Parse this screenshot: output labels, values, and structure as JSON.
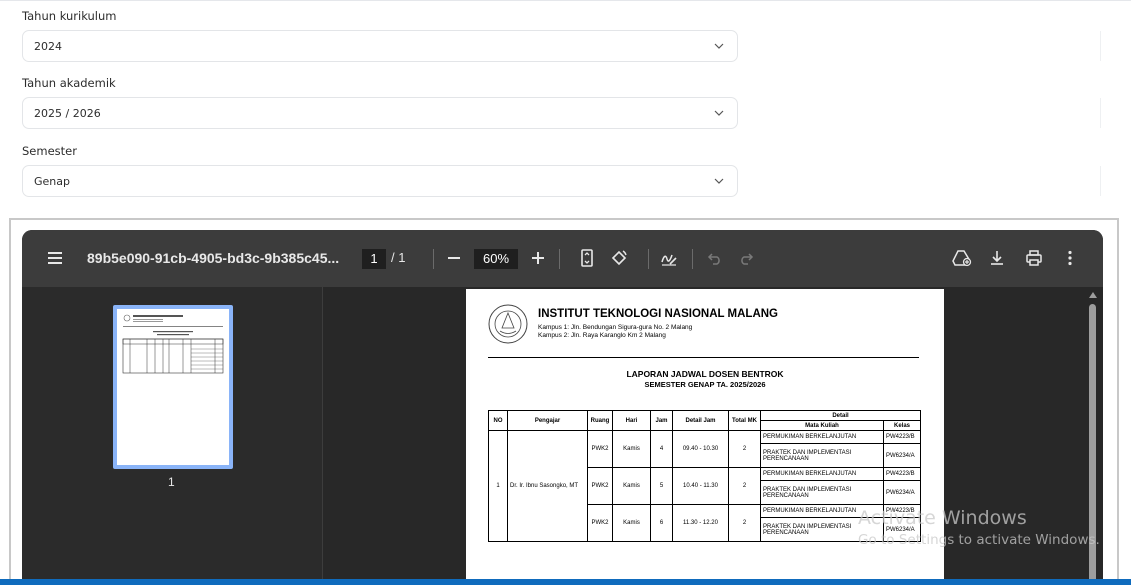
{
  "form": {
    "curriculum_year": {
      "label": "Tahun kurikulum",
      "value": "2024"
    },
    "academic_year": {
      "label": "Tahun akademik",
      "value": "2025 / 2026"
    },
    "semester": {
      "label": "Semester",
      "value": "Genap"
    }
  },
  "viewer": {
    "file_name": "89b5e090-91cb-4905-bd3c-9b385c45...",
    "current_page": "1",
    "page_separator": "/",
    "total_pages": "1",
    "zoom": "60%",
    "thumbnail_label": "1",
    "icons": {
      "menu": "menu-icon",
      "zoom_out": "minus-icon",
      "zoom_in": "plus-icon",
      "fit_page": "fit-page-icon",
      "rotate": "rotate-icon",
      "annotate": "pen-icon",
      "undo": "undo-icon",
      "redo": "redo-icon",
      "drive": "drive-add-icon",
      "download": "download-icon",
      "print": "print-icon",
      "more": "more-vertical-icon"
    }
  },
  "document": {
    "institution": "INSTITUT TEKNOLOGI NASIONAL MALANG",
    "campus1": "Kampus 1: Jln. Bendungan Sigura-gura No. 2 Malang",
    "campus2": "Kampus 2: Jln. Raya Karanglo Km 2 Malang",
    "report_title": "LAPORAN JADWAL DOSEN BENTROK",
    "report_subtitle": "SEMESTER GENAP TA. 2025/2026",
    "table": {
      "headers": {
        "no": "NO",
        "lecturer": "Pengajar",
        "room": "Ruang",
        "day": "Hari",
        "hour": "Jam",
        "time_detail": "Detail Jam",
        "total_mk": "Total MK",
        "detail": "Detail",
        "course": "Mata Kuliah",
        "class": "Kelas"
      },
      "no": "1",
      "lecturer": "Dr. Ir. Ibnu Sasongko, MT",
      "groups": [
        {
          "room": "PWK2",
          "day": "Kamis",
          "hour": "4",
          "time": "09.40 - 10.30",
          "total": "2",
          "courses": [
            {
              "name": "PERMUKIMAN BERKELANJUTAN",
              "class": "PW4223/B"
            },
            {
              "name": "PRAKTEK DAN IMPLEMENTASI PERENCANAAN",
              "class": "PW6234/A"
            }
          ]
        },
        {
          "room": "PWK2",
          "day": "Kamis",
          "hour": "5",
          "time": "10.40 - 11.30",
          "total": "2",
          "courses": [
            {
              "name": "PERMUKIMAN BERKELANJUTAN",
              "class": "PW4223/B"
            },
            {
              "name": "PRAKTEK DAN IMPLEMENTASI PERENCANAAN",
              "class": "PW6234/A"
            }
          ]
        },
        {
          "room": "PWK2",
          "day": "Kamis",
          "hour": "6",
          "time": "11.30 - 12.20",
          "total": "2",
          "courses": [
            {
              "name": "PERMUKIMAN BERKELANJUTAN",
              "class": "PW4223/B"
            },
            {
              "name": "PRAKTEK DAN IMPLEMENTASI PERENCANAAN",
              "class": "PW6234/A"
            }
          ]
        }
      ]
    }
  },
  "watermark": {
    "line1": "Activate Windows",
    "line2": "Go to Settings to activate Windows."
  },
  "colors": {
    "toolbar": "#3c3c3c",
    "viewer_bg": "#282828",
    "thumb_border": "#8ab4f8",
    "taskbar": "#0f6bbd"
  }
}
